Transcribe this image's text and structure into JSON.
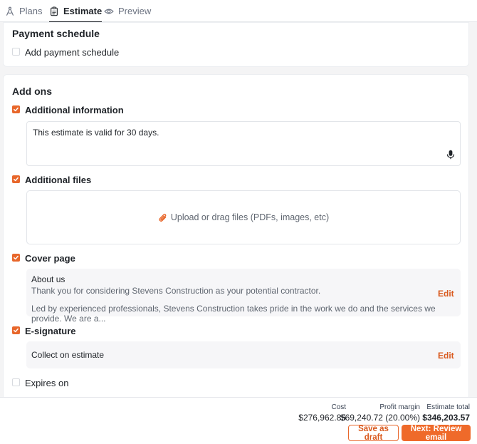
{
  "tabs": [
    {
      "label": "Plans",
      "icon": "compass-icon",
      "active": false
    },
    {
      "label": "Estimate",
      "icon": "clipboard-icon",
      "active": true
    },
    {
      "label": "Preview",
      "icon": "eye-icon",
      "active": false
    }
  ],
  "payment_schedule": {
    "title": "Payment schedule",
    "checkbox_label": "Add payment schedule",
    "checked": false
  },
  "add_ons": {
    "title": "Add ons",
    "additional_information": {
      "label": "Additional information",
      "checked": true,
      "value": "This estimate is valid for 30 days.",
      "mic_icon": "microphone-icon"
    },
    "additional_files": {
      "label": "Additional files",
      "checked": true,
      "upload_text": "Upload or drag files (PDFs, images, etc)",
      "upload_icon": "paperclip-icon"
    },
    "cover_page": {
      "label": "Cover page",
      "checked": true,
      "heading": "About us",
      "line1": "Thank you for considering Stevens Construction as your potential contractor.",
      "line2": "Led by experienced professionals, Stevens Construction takes pride in the work we do and the services we provide. We are a...",
      "edit_label": "Edit"
    },
    "e_signature": {
      "label": "E-signature",
      "checked": true,
      "value": "Collect on estimate",
      "edit_label": "Edit"
    },
    "expires_on": {
      "label": "Expires on",
      "checked": false
    }
  },
  "summary": {
    "cost_label": "Cost",
    "cost_value": "$276,962.85",
    "profit_label": "Profit margin",
    "profit_value": "$69,240.72 (20.00%)",
    "total_label": "Estimate total",
    "total_value": "$346,203.57"
  },
  "actions": {
    "draft_label": "Save as draft",
    "next_label": "Next: Review email"
  },
  "colors": {
    "accent": "#e8672b",
    "accent_text": "#d9591d",
    "primary_button": "#ef6a2a"
  }
}
